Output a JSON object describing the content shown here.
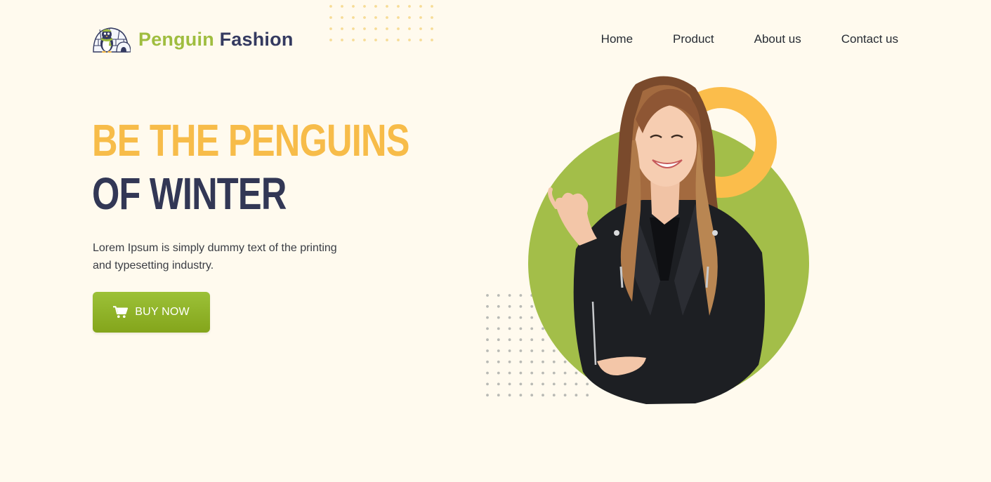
{
  "brand": {
    "name_part1": "Penguin",
    "name_part2": "Fashion",
    "logo_icon": "penguin-igloo-logo-icon",
    "colors": {
      "green": "#9fbd3f",
      "navy": "#343a60"
    }
  },
  "nav": {
    "items": [
      {
        "label": "Home"
      },
      {
        "label": "Product"
      },
      {
        "label": "About us"
      },
      {
        "label": "Contact us"
      }
    ]
  },
  "hero": {
    "headline_line1": "BE THE PENGUINS",
    "headline_line2": "OF WINTER",
    "description": "Lorem Ipsum is simply dummy text of the printing and typesetting industry.",
    "cta": {
      "label": "BUY NOW",
      "icon": "cart-icon"
    },
    "image_icon": "model-photo",
    "colors": {
      "accent_yellow": "#f7bc49",
      "accent_green": "#a3be49",
      "dark_text": "#323755",
      "background": "#fffaee"
    }
  }
}
